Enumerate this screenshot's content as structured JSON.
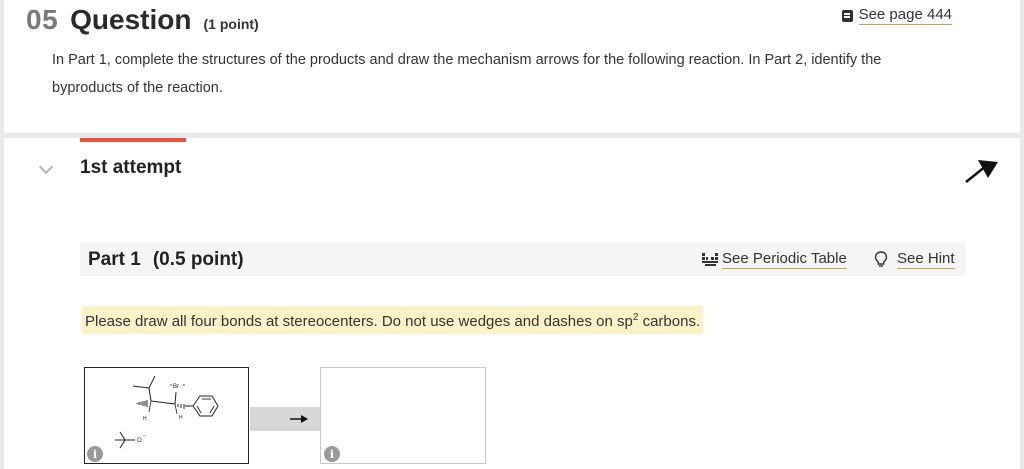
{
  "question": {
    "number": "05",
    "word": "Question",
    "points": "(1 point)",
    "see_page": "See page 444",
    "instructions": "In Part 1, complete the structures of the products and draw the mechanism arrows for the following reaction. In Part 2, identify the byproducts of the reaction."
  },
  "attempt": {
    "label": "1st attempt"
  },
  "part1": {
    "title": "Part 1",
    "points": "(0.5 point)",
    "periodic_table_link": "See Periodic Table",
    "hint_link": "See Hint",
    "note_before": "Please draw all four bonds at stereocenters. Do not use wedges and dashes on sp",
    "note_sup": "2",
    "note_after": " carbons."
  },
  "molecule": {
    "bromine_label": "Br",
    "hydrogen_label": "H",
    "base_anion_label": "O"
  },
  "icons": {
    "book": "book-icon",
    "periodic_table": "periodic-table-icon",
    "hint": "lightbulb-icon",
    "collapse": "arrow-pointer-icon",
    "info": "info-icon"
  },
  "colors": {
    "accent": "#e8533a",
    "link_underline": "#c8a14a",
    "highlight": "#fbf3c8"
  }
}
